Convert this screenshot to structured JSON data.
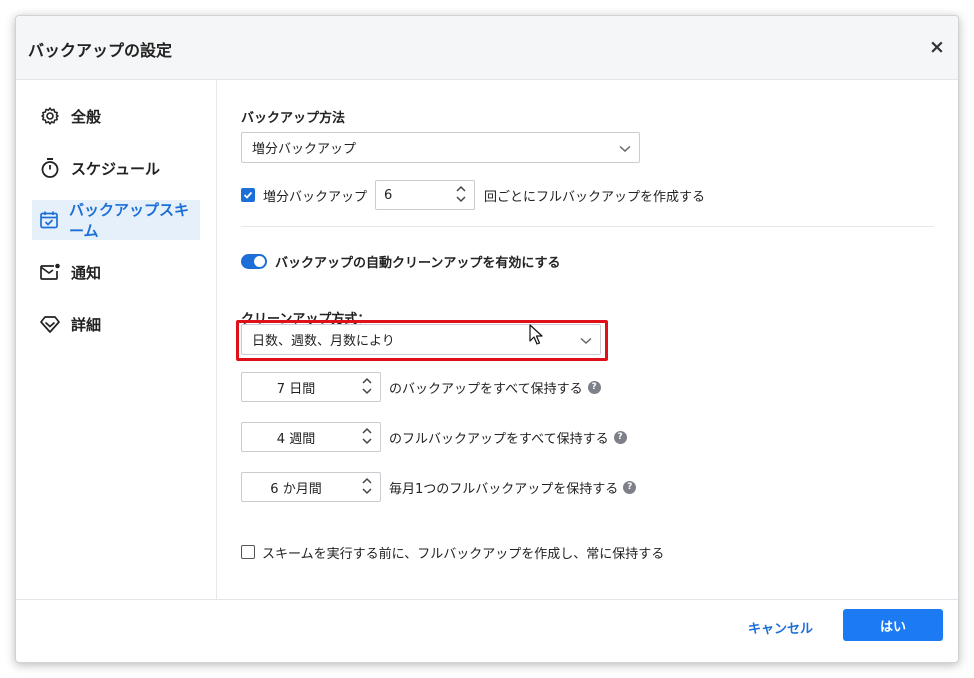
{
  "dialog": {
    "title": "バックアップの設定",
    "close_label": "×"
  },
  "sidebar": {
    "items": [
      {
        "label": "全般",
        "icon": "gear-icon",
        "active": false
      },
      {
        "label": "スケジュール",
        "icon": "timer-icon",
        "active": false
      },
      {
        "label": "バックアップスキーム",
        "icon": "calendar-check-icon",
        "active": true
      },
      {
        "label": "通知",
        "icon": "mail-icon",
        "active": false
      },
      {
        "label": "詳細",
        "icon": "diamond-icon",
        "active": false
      }
    ]
  },
  "main": {
    "backup_method_label": "バックアップ方法",
    "backup_method_value": "増分バックアップ",
    "incremental_checkbox_checked": true,
    "incremental_label": "増分バックアップ",
    "incremental_count": "6",
    "incremental_suffix": "回ごとにフルバックアップを作成する",
    "auto_cleanup_enabled": true,
    "auto_cleanup_label": "バックアップの自動クリーンアップを有効にする",
    "cleanup_method_label": "クリーンアップ方式：",
    "cleanup_method_value": "日数、週数、月数により",
    "retention": [
      {
        "value": "7 日間",
        "label": "のバックアップをすべて保持する"
      },
      {
        "value": "4 週間",
        "label": "のフルバックアップをすべて保持する"
      },
      {
        "value": "6 か月間",
        "label": "毎月1つのフルバックアップを保持する"
      }
    ],
    "keep_full_checked": false,
    "keep_full_label": "スキームを実行する前に、フルバックアップを作成し、常に保持する"
  },
  "footer": {
    "cancel_label": "キャンセル",
    "ok_label": "はい"
  },
  "colors": {
    "accent": "#1c6fd6",
    "highlight": "#e0101b"
  }
}
